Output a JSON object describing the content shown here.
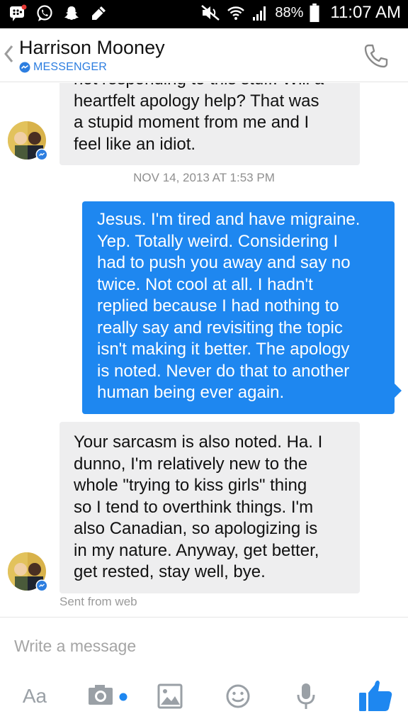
{
  "status_bar": {
    "battery_percent": "88%",
    "time": "11:07 AM",
    "icons": [
      "bbm-icon",
      "whatsapp-icon",
      "snapchat-icon",
      "pencil-icon",
      "mute-icon",
      "wifi-icon",
      "signal-icon",
      "battery-icon"
    ]
  },
  "header": {
    "contact_name": "Harrison Mooney",
    "subtitle": "MESSENGER",
    "icons": [
      "back-chevron-icon",
      "phone-icon"
    ]
  },
  "conversation": {
    "messages": [
      {
        "direction": "incoming",
        "lines": [
          "not responding to this stuff. Will a",
          "heartfelt apology help? That was",
          "a stupid moment from me and I",
          "feel like an idiot."
        ]
      },
      {
        "direction": "outgoing",
        "lines": [
          "Jesus. I'm tired and have migraine.",
          "Yep. Totally weird. Considering I",
          "had to push you away and say no",
          "twice. Not cool at all. I hadn't",
          "replied because I had nothing to",
          "really say and revisiting the topic",
          "isn't making it better. The apology",
          "is noted. Never do that to another",
          "human being ever again."
        ]
      },
      {
        "direction": "incoming",
        "lines": [
          "Your sarcasm is also noted. Ha. I",
          "dunno, I'm relatively new to the",
          "whole \"trying to kiss girls\" thing",
          "so I tend to overthink things. I'm",
          "also Canadian, so apologizing is",
          "in my nature. Anyway, get better,",
          "get rested, stay well, bye."
        ]
      }
    ],
    "timestamp": "NOV 14, 2013 AT 1:53 PM",
    "sent_from": "Sent from web"
  },
  "composer": {
    "placeholder": "Write a message",
    "aa_label": "Aa",
    "icons": [
      "camera-icon",
      "photo-icon",
      "emoji-icon",
      "microphone-icon",
      "thumbs-up-icon"
    ]
  },
  "colors": {
    "accent_blue": "#1e87f0",
    "incoming_bubble": "#eeeeef",
    "messenger_blue": "#2d7ee0",
    "status_bar": "#000000"
  }
}
